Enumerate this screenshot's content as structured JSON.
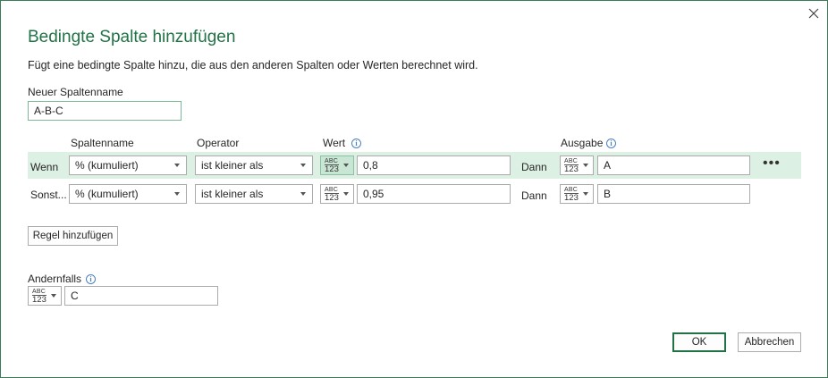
{
  "dialog": {
    "title": "Bedingte Spalte hinzufügen",
    "subtitle": "Fügt eine bedingte Spalte hinzu, die aus den anderen Spalten oder Werten berechnet wird.",
    "close_icon": "close-icon"
  },
  "column_name": {
    "label": "Neuer Spaltenname",
    "value": "A-B-C"
  },
  "headers": {
    "column": "Spaltenname",
    "operator": "Operator",
    "value": "Wert",
    "output": "Ausgabe"
  },
  "type_badge": {
    "top": "ABC",
    "bottom": "123"
  },
  "rules": [
    {
      "prefix": "Wenn",
      "column": "% (kumuliert)",
      "operator": "ist kleiner als",
      "value": "0,8",
      "then": "Dann",
      "output": "A"
    },
    {
      "prefix": "Sonst...",
      "column": "% (kumuliert)",
      "operator": "ist kleiner als",
      "value": "0,95",
      "then": "Dann",
      "output": "B"
    }
  ],
  "more_icon": "ellipsis-icon",
  "add_rule_label": "Regel hinzufügen",
  "otherwise": {
    "label": "Andernfalls",
    "value": "C"
  },
  "buttons": {
    "ok": "OK",
    "cancel": "Abbrechen"
  },
  "colors": {
    "accent": "#217346",
    "highlight_row": "#dcf0e3"
  }
}
